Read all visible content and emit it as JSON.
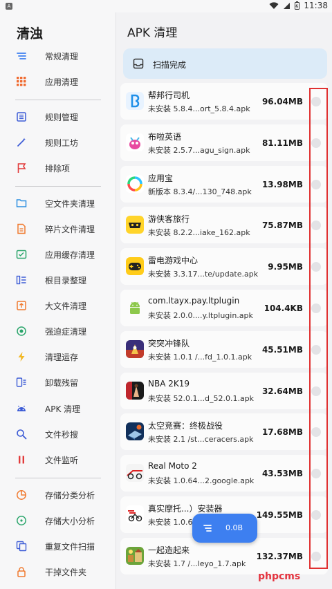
{
  "status_bar": {
    "time": "11:38"
  },
  "sidebar": {
    "title": "清浊",
    "groups": [
      [
        {
          "label": "常规清理",
          "icon": "clean-lines-icon"
        },
        {
          "label": "应用清理",
          "icon": "app-grid-icon"
        }
      ],
      [
        {
          "label": "规则管理",
          "icon": "rule-list-icon"
        },
        {
          "label": "规则工坊",
          "icon": "magic-wand-icon"
        },
        {
          "label": "排除项",
          "icon": "flag-icon"
        }
      ],
      [
        {
          "label": "空文件夹清理",
          "icon": "folder-icon"
        },
        {
          "label": "碎片文件清理",
          "icon": "file-fragment-icon"
        },
        {
          "label": "应用缓存清理",
          "icon": "cache-icon"
        },
        {
          "label": "根目录整理",
          "icon": "root-dir-icon"
        },
        {
          "label": "大文件清理",
          "icon": "big-file-icon"
        },
        {
          "label": "强迫症清理",
          "icon": "ocd-icon"
        },
        {
          "label": "清理运存",
          "icon": "lightning-icon"
        },
        {
          "label": "卸载残留",
          "icon": "uninstall-icon"
        },
        {
          "label": "APK 清理",
          "icon": "android-icon"
        },
        {
          "label": "文件秒搜",
          "icon": "search-icon"
        },
        {
          "label": "文件监听",
          "icon": "pause-icon"
        }
      ],
      [
        {
          "label": "存储分类分析",
          "icon": "pie-chart-icon"
        },
        {
          "label": "存储大小分析",
          "icon": "storage-size-icon"
        },
        {
          "label": "重复文件扫描",
          "icon": "duplicate-icon"
        },
        {
          "label": "干掉文件夹",
          "icon": "lock-icon"
        }
      ]
    ]
  },
  "main": {
    "title": "APK 清理",
    "scan_status": "扫描完成",
    "items": [
      {
        "name": "帮邦行司机",
        "sub": "未安装 5.8.4...ort_5.8.4.apk",
        "size": "96.04MB",
        "icon": "bangbang-app-icon"
      },
      {
        "name": "布啦英语",
        "sub": "未安装 2.5.7...agu_sign.apk",
        "size": "81.11MB",
        "icon": "bula-app-icon"
      },
      {
        "name": "应用宝",
        "sub": "新版本 8.3.4/...130_748.apk",
        "size": "13.98MB",
        "icon": "yingyongbao-app-icon"
      },
      {
        "name": "游侠客旅行",
        "sub": "未安装 8.2.2...iake_162.apk",
        "size": "75.87MB",
        "icon": "youxiake-app-icon"
      },
      {
        "name": "雷电游戏中心",
        "sub": "未安装 3.3.17...te/update.apk",
        "size": "9.95MB",
        "icon": "gamepad-app-icon"
      },
      {
        "name": "com.ltayx.pay.ltplugin",
        "sub": "未安装 2.0.0....y.ltplugin.apk",
        "size": "104.4KB",
        "icon": "android-app-icon"
      },
      {
        "name": "突突冲锋队",
        "sub": "未安装 1.0.1 /...fd_1.0.1.apk",
        "size": "45.51MB",
        "icon": "game-thumb-icon"
      },
      {
        "name": "NBA 2K19",
        "sub": "未安装 52.0.1...d_52.0.1.apk",
        "size": "32.64MB",
        "icon": "nba-app-icon"
      },
      {
        "name": "太空竞赛：终极战役",
        "sub": "未安装 2.1 /st...ceracers.apk",
        "size": "17.68MB",
        "icon": "space-race-app-icon"
      },
      {
        "name": "Real Moto 2",
        "sub": "未安装 1.0.64...2.google.apk",
        "size": "43.53MB",
        "icon": "real-moto-app-icon"
      },
      {
        "name": "真实摩托...）安装器",
        "sub": "未安装 1.0.6...",
        "size": "149.55MB",
        "icon": "moto-installer-app-icon"
      },
      {
        "name": "一起造起来",
        "sub": "未安装 1.7 /...leyo_1.7.apk",
        "size": "132.37MB",
        "icon": "build-together-app-icon"
      }
    ]
  },
  "fab": {
    "label": "0.0B"
  },
  "watermark": "phpcms",
  "colors": {
    "accent": "#3d7ff0",
    "scan_card": "#dcebf8",
    "highlight_box": "#e03131",
    "watermark": "#e4343f"
  }
}
